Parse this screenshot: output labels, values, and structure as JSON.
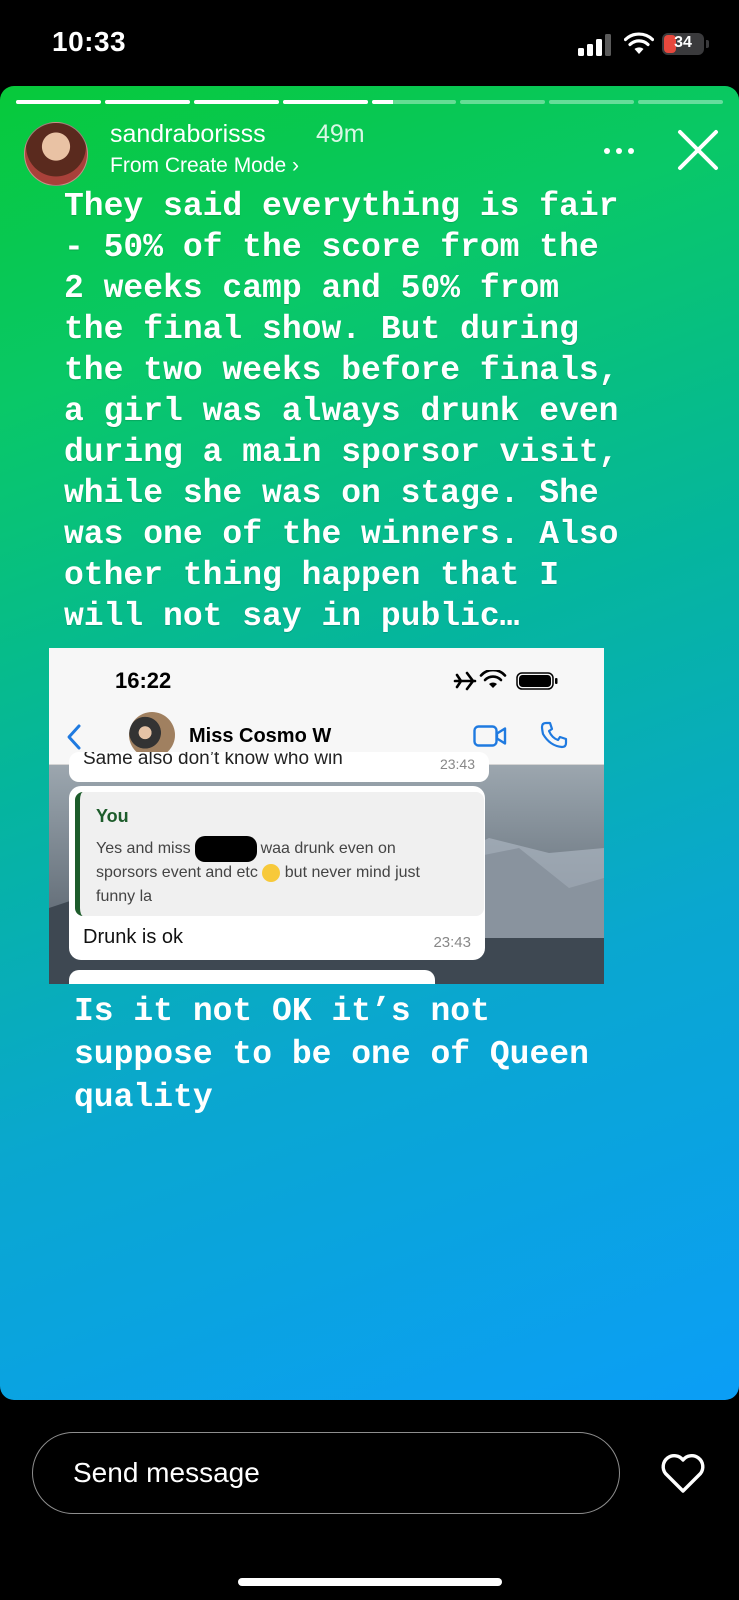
{
  "status_bar": {
    "time": "10:33",
    "battery": "34",
    "icons": [
      "signal-icon",
      "wifi-icon",
      "battery-icon"
    ]
  },
  "story": {
    "segments_total": 8,
    "segments_completed": 4,
    "current_segment_progress": 0.25,
    "gradient_colors": [
      "#07c93a",
      "#09c867",
      "#05b59e",
      "#0aa7cf",
      "#0b9ef6"
    ],
    "header": {
      "username": "sandraborisss",
      "time_ago": "49m",
      "subtitle": "From Create Mode ›",
      "more_icon": "more-icon",
      "close_icon": "close-icon"
    },
    "text_main": "They said everything is fair\n- 50% of the score from the\n2 weeks camp and 50% from\nthe final show. But during\nthe two weeks before finals,\na girl was always drunk even\nduring a main sporsor visit,\nwhile she was on stage. She\nwas one of the winners. Also\nother thing happen that I\nwill not say in public…",
    "text_secondary": "Is it not OK it’s not\nsuppose to be one of Queen\nquality",
    "embedded_chat": {
      "time": "16:22",
      "contact_name": "Miss Cosmo W",
      "cut_message_text": "Same also don’t know who win",
      "cut_message_time": "23:43",
      "reply_author": "You",
      "reply_line_1_a": "Yes and miss",
      "reply_line_1_b": "waa drunk even on",
      "reply_line_2_a": "sporsors event and etc",
      "reply_line_2_b": "but never mind just",
      "reply_line_3": "funny la",
      "message_text": "Drunk is ok",
      "message_time": "23:43"
    }
  },
  "reply_bar": {
    "placeholder": "Send message",
    "heart_icon": "heart-icon"
  }
}
